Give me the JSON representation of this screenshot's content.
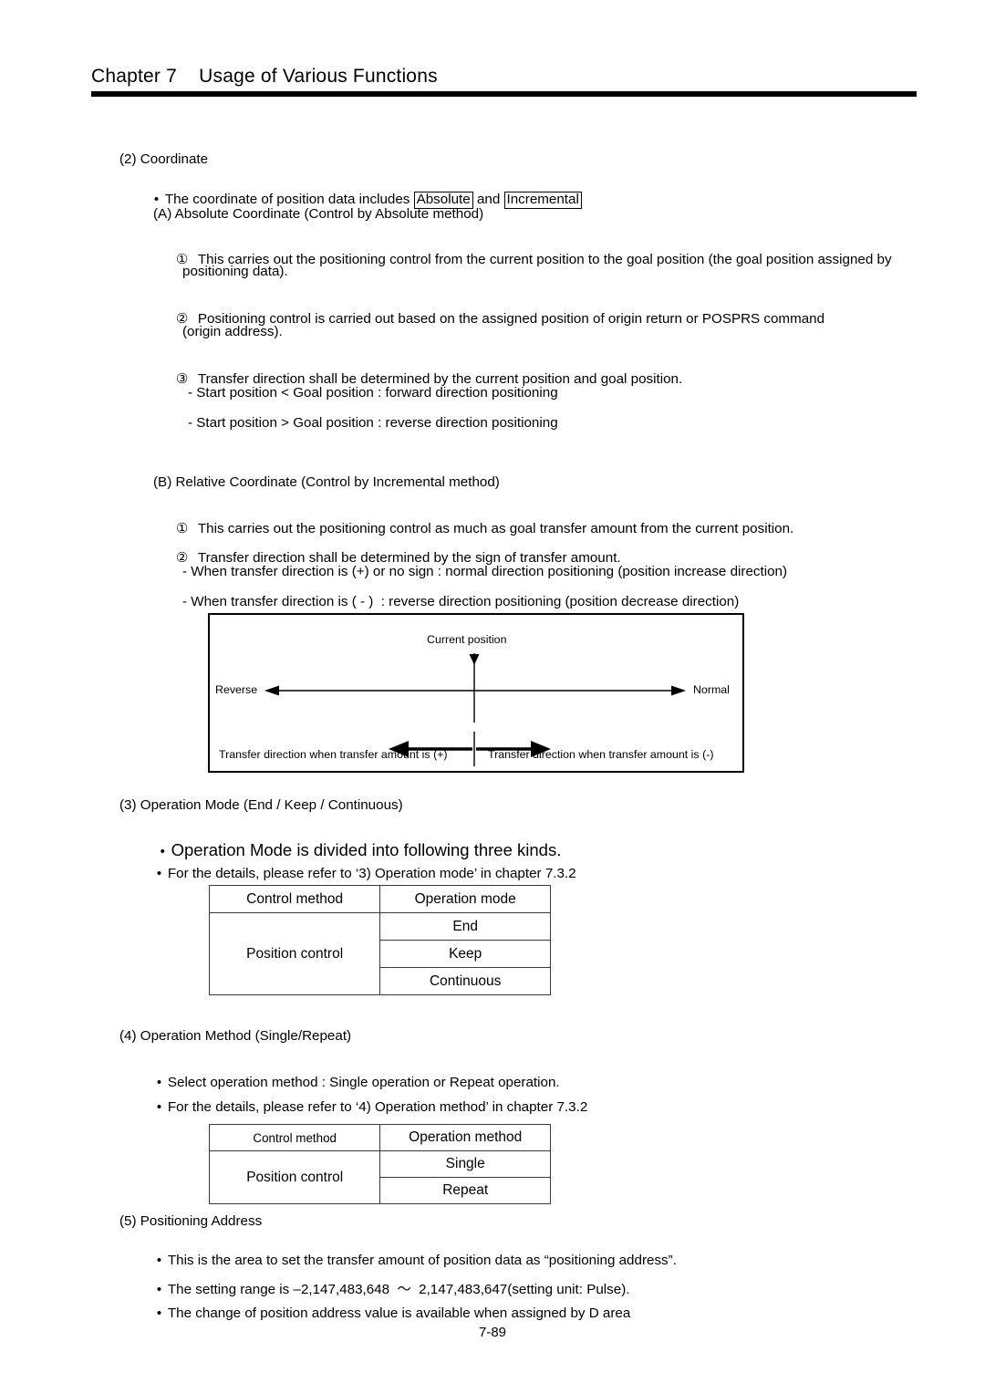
{
  "header": {
    "chapter": "Chapter 7",
    "title": "Usage of Various Functions",
    "combined": "Chapter 7    Usage of Various Functions"
  },
  "sections": {
    "coordinate": {
      "heading": "(2) Coordinate",
      "bullet_prefix": "The coordinate of position data includes ",
      "boxed_absolute": "Absolute",
      "bullet_middle": " and ",
      "boxed_incremental": "Incremental",
      "sub_a": {
        "heading": "(A) Absolute Coordinate (Control by Absolute method)",
        "item1_num": "①",
        "item1_line1": "This carries out the positioning control from the current position to the goal position (the goal position assigned by",
        "item1_line2": "positioning data).",
        "item2_num": "②",
        "item2_line1": "Positioning control is carried out based on the assigned position of origin return or POSPRS command",
        "item2_line2": "(origin address).",
        "item3_num": "③",
        "item3_line1": "Transfer direction shall be determined by the current position and goal position.",
        "dash1": "- Start position < Goal position : forward direction positioning",
        "dash2": "- Start position > Goal position : reverse direction positioning"
      },
      "sub_b": {
        "heading": "(B) Relative Coordinate (Control by Incremental method)",
        "item1_num": "①",
        "item1_line1": "This carries out the positioning control as much as goal transfer amount from the current position.",
        "item2_num": "②",
        "item2_line1": "Transfer direction shall be determined by the sign of transfer amount.",
        "dash1": "- When transfer direction is (+) or no sign : normal direction positioning (position increase direction)",
        "dash2": "- When transfer direction is ( - )  : reverse direction positioning (position decrease direction)"
      }
    },
    "operation_mode": {
      "heading": "(3) Operation Mode (End / Keep / Continuous)",
      "bullet1": "Operation Mode is divided into following three kinds.",
      "bullet2": "For the details, please refer to ‘3) Operation mode’ in chapter 7.3.2"
    },
    "operation_method": {
      "heading": "(4) Operation Method (Single/Repeat)",
      "bullet1": "Select operation method : Single operation or Repeat operation.",
      "bullet2": "For the details, please refer to ‘4) Operation method’ in chapter 7.3.2"
    },
    "positioning_address": {
      "heading": "(5) Positioning Address",
      "bullet1": "This is the area to set the transfer amount of position data as “positioning address”.",
      "bullet2": "The setting range is –2,147,483,648  ～  2,147,483,647(setting unit: Pulse).",
      "bullet3": "The change of position address value is available when assigned by D area"
    }
  },
  "diagram": {
    "current_position_label": "Current position",
    "reverse_label": "Reverse",
    "normal_label": "Normal",
    "transfer_plus_label": "Transfer direction when transfer amount is (+)",
    "transfer_minus_label": "Transfer direction when transfer amount is (-)"
  },
  "table_mode": {
    "headers": [
      "Control method",
      "Operation mode"
    ],
    "row_label": "Position control",
    "values": [
      "End",
      "Keep",
      "Continuous"
    ]
  },
  "table_method": {
    "headers": [
      "Control method",
      "Operation method"
    ],
    "row_label": "Position control",
    "values": [
      "Single",
      "Repeat"
    ]
  },
  "footer": {
    "page_number": "7-89"
  },
  "bullet_glyph": "•",
  "colors": {
    "text": "#000000",
    "rule": "#000000",
    "table_border": "#3a3a3a",
    "background": "#ffffff"
  }
}
